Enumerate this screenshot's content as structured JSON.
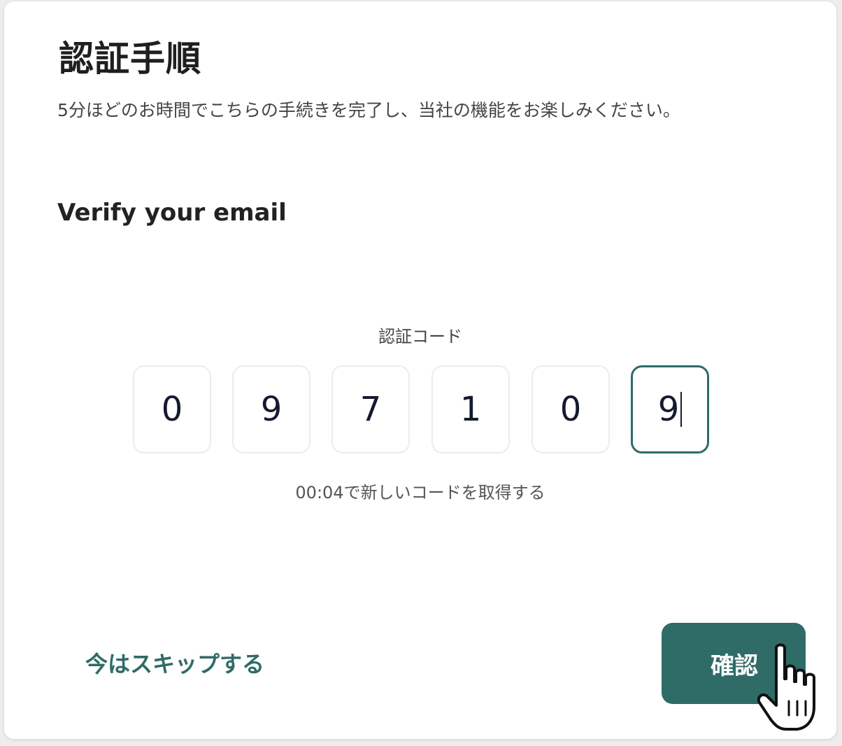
{
  "header": {
    "title": "認証手順",
    "subtitle": "5分ほどのお時間でこちらの手続きを完了し、当社の機能をお楽しみください。"
  },
  "section": {
    "title": "Verify your email"
  },
  "code": {
    "label": "認証コード",
    "digits": [
      "0",
      "9",
      "7",
      "1",
      "0",
      "9"
    ],
    "active_index": 5
  },
  "resend": {
    "text": "00:04で新しいコードを取得する"
  },
  "actions": {
    "skip_label": "今はスキップする",
    "confirm_label": "確認"
  },
  "colors": {
    "accent": "#2f6b67",
    "digit_text": "#161a2e"
  },
  "icons": {
    "pointer": "hand-pointer-icon"
  }
}
